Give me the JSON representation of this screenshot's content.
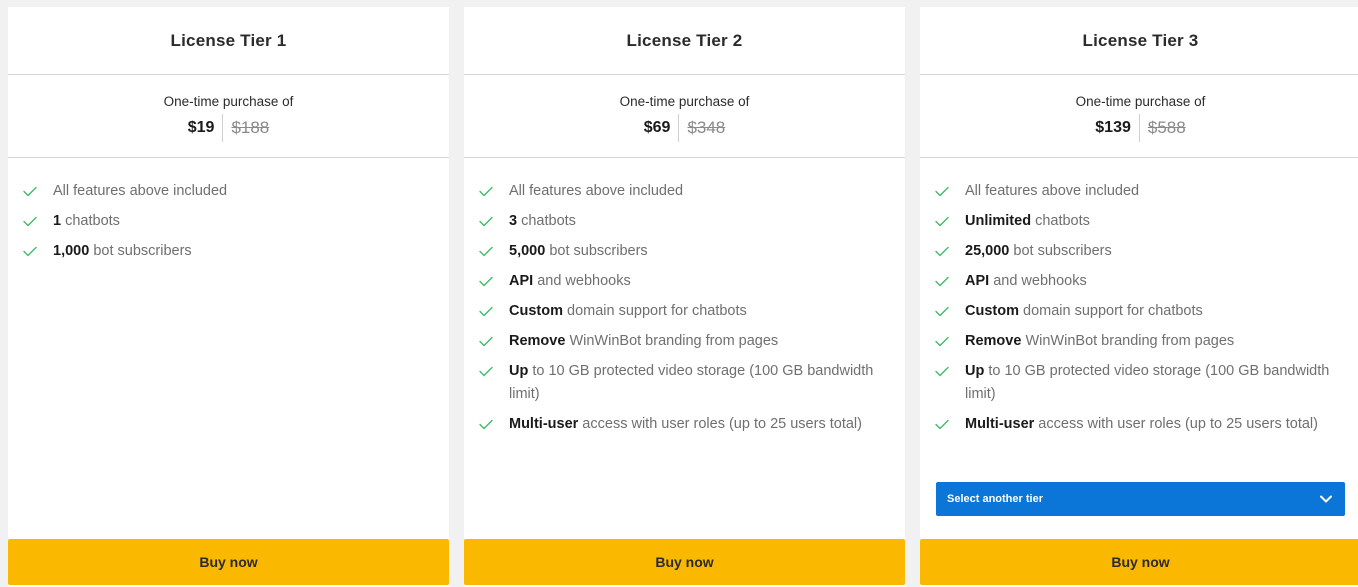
{
  "tiers": [
    {
      "title": "License Tier 1",
      "price_caption": "One-time purchase of",
      "price_now": "$19",
      "price_old": "$188",
      "features": [
        {
          "bold": "",
          "text": "All features above included"
        },
        {
          "bold": "1",
          "text": " chatbots"
        },
        {
          "bold": "1,000",
          "text": " bot subscribers"
        }
      ],
      "buy_label": "Buy now"
    },
    {
      "title": "License Tier 2",
      "price_caption": "One-time purchase of",
      "price_now": "$69",
      "price_old": "$348",
      "features": [
        {
          "bold": "",
          "text": "All features above included"
        },
        {
          "bold": "3",
          "text": " chatbots"
        },
        {
          "bold": "5,000",
          "text": " bot subscribers"
        },
        {
          "bold": "API",
          "text": " and webhooks"
        },
        {
          "bold": "Custom",
          "text": " domain support for chatbots"
        },
        {
          "bold": "Remove",
          "text": " WinWinBot branding from pages"
        },
        {
          "bold": "Up",
          "text": " to 10 GB protected video storage (100 GB bandwidth limit)"
        },
        {
          "bold": "Multi-user",
          "text": " access with user roles (up to 25 users total)"
        }
      ],
      "buy_label": "Buy now"
    },
    {
      "title": "License Tier 3",
      "price_caption": "One-time purchase of",
      "price_now": "$139",
      "price_old": "$588",
      "features": [
        {
          "bold": "",
          "text": "All features above included"
        },
        {
          "bold": "Unlimited",
          "text": " chatbots"
        },
        {
          "bold": "25,000",
          "text": " bot subscribers"
        },
        {
          "bold": "API",
          "text": " and webhooks"
        },
        {
          "bold": "Custom",
          "text": " domain support for chatbots"
        },
        {
          "bold": "Remove",
          "text": " WinWinBot branding from pages"
        },
        {
          "bold": "Up",
          "text": " to 10 GB protected video storage (100 GB bandwidth limit)"
        },
        {
          "bold": "Multi-user",
          "text": " access with user roles (up to 25 users total)"
        }
      ],
      "select_label": "Select another tier",
      "buy_label": "Buy now"
    }
  ],
  "icons": {
    "feature_check": "check-icon",
    "select_chevron": "chevron-down-icon"
  },
  "colors": {
    "check": "#3cb964",
    "buy_button": "#fbb800",
    "select_background": "#0c75d8"
  }
}
